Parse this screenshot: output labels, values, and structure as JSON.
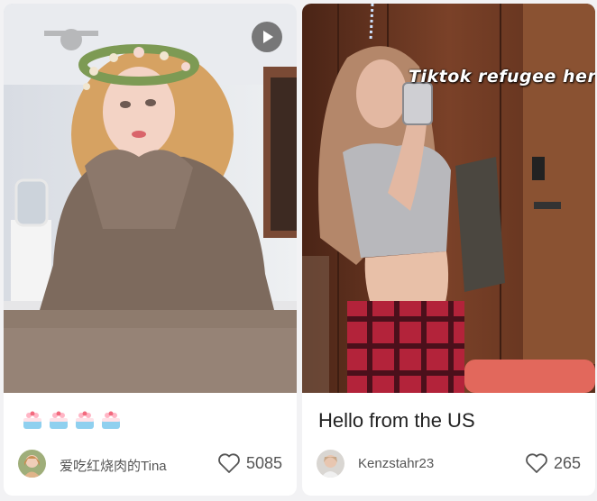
{
  "cards": [
    {
      "caption_icons": [
        "cake-emoji-icon",
        "cake-emoji-icon",
        "cake-emoji-icon",
        "cake-emoji-icon"
      ],
      "author": "爱吃红烧肉的Tina",
      "likes": "5085",
      "has_video": true,
      "colors": {
        "sweater": "#7d6a5d",
        "hair": "#d6a262",
        "wall": "#dde0e6"
      }
    },
    {
      "overlay_text": "Tiktok refugee here",
      "caption": "Hello from the US",
      "author": "Kenzstahr23",
      "likes": "265",
      "colors": {
        "wood": "#6b3a22",
        "plaid": "#b3233a",
        "shirt": "#b8b8bc"
      }
    }
  ]
}
